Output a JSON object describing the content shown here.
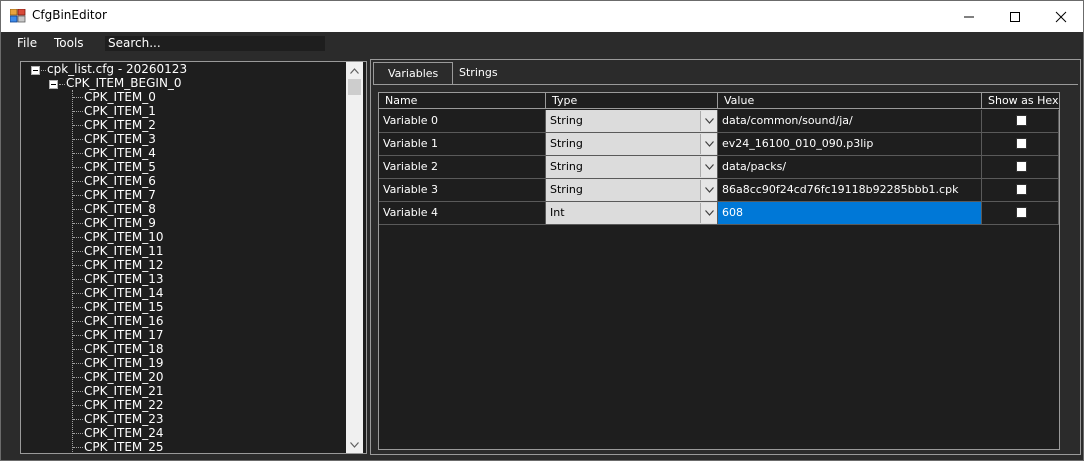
{
  "window": {
    "title": "CfgBinEditor"
  },
  "menu": {
    "file": "File",
    "tools": "Tools",
    "search_value": "Search..."
  },
  "tree": {
    "root": "cpk_list.cfg - 20260123",
    "group": "CPK_ITEM_BEGIN_0",
    "items": [
      "CPK_ITEM_0",
      "CPK_ITEM_1",
      "CPK_ITEM_2",
      "CPK_ITEM_3",
      "CPK_ITEM_4",
      "CPK_ITEM_5",
      "CPK_ITEM_6",
      "CPK_ITEM_7",
      "CPK_ITEM_8",
      "CPK_ITEM_9",
      "CPK_ITEM_10",
      "CPK_ITEM_11",
      "CPK_ITEM_12",
      "CPK_ITEM_13",
      "CPK_ITEM_14",
      "CPK_ITEM_15",
      "CPK_ITEM_16",
      "CPK_ITEM_17",
      "CPK_ITEM_18",
      "CPK_ITEM_19",
      "CPK_ITEM_20",
      "CPK_ITEM_21",
      "CPK_ITEM_22",
      "CPK_ITEM_23",
      "CPK_ITEM_24",
      "CPK_ITEM_25"
    ]
  },
  "tabs": {
    "variables": "Variables",
    "strings": "Strings"
  },
  "grid": {
    "headers": {
      "name": "Name",
      "type": "Type",
      "value": "Value",
      "hex": "Show as Hex"
    },
    "rows": [
      {
        "name": "Variable 0",
        "type": "String",
        "value": "data/common/sound/ja/",
        "hex": false
      },
      {
        "name": "Variable 1",
        "type": "String",
        "value": "ev24_16100_010_090.p3lip",
        "hex": false
      },
      {
        "name": "Variable 2",
        "type": "String",
        "value": "data/packs/",
        "hex": false
      },
      {
        "name": "Variable 3",
        "type": "String",
        "value": "86a8cc90f24cd76fc19118b92285bbb1.cpk",
        "hex": false
      },
      {
        "name": "Variable 4",
        "type": "Int",
        "value": "608",
        "hex": false
      }
    ]
  },
  "colors": {
    "selection": "#0078d7",
    "background": "#2b2b2b",
    "panel": "#1e1e1e"
  }
}
